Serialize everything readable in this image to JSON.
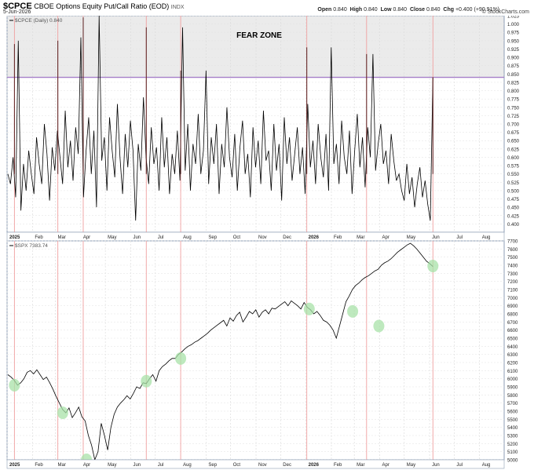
{
  "header": {
    "symbol": "$CPCE",
    "name": "CBOE Options Equity Put/Call Ratio (EOD)",
    "exchange": "INDX",
    "date": "5-Jun-2026",
    "brand": "© StockCharts.com",
    "ohlc": {
      "open_label": "Open",
      "open": "0.840",
      "high_label": "High",
      "high": "0.840",
      "low_label": "Low",
      "low": "0.840",
      "close_label": "Close",
      "close": "0.840",
      "chg_label": "Chg",
      "chg": "+0.400 (+90.91%)"
    }
  },
  "colors": {
    "frame": "#8e9eb4",
    "fear_zone_fill": "#ebebeb",
    "threshold_line": "#a57ec8",
    "event_line": "#f0a0a0",
    "marker_fill": "#a8e2a8",
    "price_line": "#000000"
  },
  "chart_data": [
    {
      "type": "line",
      "legend": "$CPCE (Daily) 0.840",
      "annotation": "FEAR ZONE",
      "ylim": [
        0.375,
        1.025
      ],
      "yticks": [
        0.4,
        0.425,
        0.45,
        0.475,
        0.5,
        0.525,
        0.55,
        0.575,
        0.6,
        0.625,
        0.65,
        0.675,
        0.7,
        0.725,
        0.75,
        0.775,
        0.8,
        0.825,
        0.85,
        0.875,
        0.9,
        0.925,
        0.95,
        0.975,
        1.0,
        1.025
      ],
      "fear_zone": [
        0.84,
        1.025
      ],
      "x_tick_labels": [
        "2025",
        "Feb",
        "Mar",
        "Apr",
        "May",
        "Jun",
        "Jul",
        "Aug",
        "Sep",
        "Oct",
        "Nov",
        "Dec",
        "2026",
        "Feb",
        "Mar",
        "Apr",
        "May",
        "Jun",
        "Jul",
        "Aug"
      ],
      "spikes": [
        {
          "date": "2025-01-10",
          "value": 0.94
        },
        {
          "date": "2025-03-04",
          "value": 0.95
        },
        {
          "date": "2025-04-04",
          "value": 1.02
        },
        {
          "date": "2025-06-20",
          "value": 0.99
        },
        {
          "date": "2025-08-01",
          "value": 0.86
        },
        {
          "date": "2026-01-02",
          "value": 0.93
        },
        {
          "date": "2026-03-16",
          "value": 0.91
        },
        {
          "date": "2026-06-05",
          "value": 0.84
        }
      ],
      "series": [
        {
          "values": [
            0.55,
            0.52,
            0.6,
            0.48,
            0.95,
            0.44,
            0.58,
            0.5,
            0.62,
            0.55,
            0.49,
            0.66,
            0.58,
            0.52,
            0.7,
            0.61,
            0.47,
            0.63,
            0.56,
            0.68,
            0.6,
            0.52,
            0.74,
            0.57,
            0.65,
            0.53,
            0.69,
            0.61,
            0.96,
            0.48,
            0.62,
            0.72,
            0.55,
            0.68,
            0.45,
            1.03,
            0.59,
            0.66,
            0.5,
            0.72,
            0.62,
            0.54,
            0.76,
            0.6,
            0.49,
            0.67,
            0.57,
            0.71,
            0.62,
            0.41,
            0.64,
            0.56,
            0.78,
            0.6,
            0.52,
            0.69,
            0.58,
            0.63,
            0.5,
            0.72,
            0.57,
            0.66,
            0.49,
            0.61,
            0.55,
            0.68,
            0.53,
            0.99,
            0.56,
            0.7,
            0.5,
            0.64,
            0.58,
            0.73,
            0.55,
            0.62,
            0.86,
            0.52,
            0.66,
            0.58,
            0.7,
            0.49,
            0.64,
            0.57,
            0.75,
            0.6,
            0.54,
            0.67,
            0.5,
            0.63,
            0.71,
            0.55,
            0.61,
            0.48,
            0.69,
            0.57,
            0.65,
            0.52,
            0.74,
            0.59,
            0.62,
            0.5,
            0.7,
            0.56,
            0.64,
            0.47,
            0.72,
            0.58,
            0.66,
            0.53,
            0.61,
            0.69,
            0.55,
            0.63,
            0.49,
            0.76,
            0.57,
            0.65,
            0.52,
            0.7,
            0.6,
            0.54,
            0.67,
            0.5,
            0.93,
            0.58,
            0.64,
            0.52,
            0.71,
            0.6,
            0.55,
            0.68,
            0.49,
            0.62,
            0.73,
            0.57,
            0.66,
            0.51,
            0.69,
            0.6,
            0.91,
            0.56,
            0.64,
            0.7,
            0.58,
            0.62,
            0.52,
            0.67,
            0.59,
            0.53,
            0.55,
            0.5,
            0.47,
            0.58,
            0.49,
            0.54,
            0.45,
            0.52,
            0.57,
            0.48,
            0.53,
            0.46,
            0.41,
            0.84
          ]
        }
      ]
    },
    {
      "type": "line",
      "legend": "$SPX 7383.74",
      "ylim": [
        5000,
        7700
      ],
      "yticks": [
        5000,
        5100,
        5200,
        5300,
        5400,
        5500,
        5600,
        5700,
        5800,
        5900,
        6000,
        6100,
        6200,
        6300,
        6400,
        6500,
        6600,
        6700,
        6800,
        6900,
        7000,
        7100,
        7200,
        7300,
        7400,
        7500,
        7600,
        7700
      ],
      "x_tick_labels": [
        "2025",
        "Feb",
        "Mar",
        "Apr",
        "May",
        "Jun",
        "Jul",
        "Aug",
        "Sep",
        "Oct",
        "Nov",
        "Dec",
        "2026",
        "Feb",
        "Mar",
        "Apr",
        "May",
        "Jun",
        "Jul",
        "Aug"
      ],
      "highlights": [
        {
          "date": "2025-01-10",
          "value": 5920
        },
        {
          "date": "2025-03-10",
          "value": 5580
        },
        {
          "date": "2025-04-08",
          "value": 5000
        },
        {
          "date": "2025-06-20",
          "value": 5970
        },
        {
          "date": "2025-08-01",
          "value": 6250
        },
        {
          "date": "2026-01-05",
          "value": 6860
        },
        {
          "date": "2026-02-27",
          "value": 6830
        },
        {
          "date": "2026-03-31",
          "value": 6650
        },
        {
          "date": "2026-06-05",
          "value": 7390
        }
      ],
      "series": [
        {
          "values": [
            6050,
            6020,
            5980,
            5920,
            5950,
            6000,
            6080,
            6100,
            6060,
            6110,
            6050,
            5990,
            6020,
            5950,
            5870,
            5780,
            5700,
            5620,
            5580,
            5640,
            5520,
            5580,
            5650,
            5530,
            5480,
            5300,
            5180,
            5000,
            5100,
            5450,
            5300,
            5120,
            5400,
            5560,
            5650,
            5700,
            5740,
            5790,
            5750,
            5820,
            5900,
            5880,
            5950,
            5940,
            6000,
            6050,
            5970,
            6100,
            6150,
            6180,
            6220,
            6250,
            6250,
            6300,
            6330,
            6370,
            6400,
            6420,
            6450,
            6470,
            6500,
            6530,
            6560,
            6600,
            6630,
            6660,
            6690,
            6720,
            6650,
            6750,
            6710,
            6780,
            6820,
            6700,
            6760,
            6830,
            6800,
            6850,
            6760,
            6820,
            6850,
            6800,
            6870,
            6860,
            6890,
            6920,
            6950,
            6900,
            6960,
            6930,
            6900,
            6860,
            6940,
            6880,
            6850,
            6800,
            6830,
            6780,
            6720,
            6700,
            6660,
            6600,
            6500,
            6650,
            6800,
            6950,
            7020,
            7100,
            7150,
            7180,
            7220,
            7250,
            7270,
            7300,
            7330,
            7350,
            7400,
            7430,
            7450,
            7480,
            7520,
            7560,
            7590,
            7620,
            7650,
            7670,
            7640,
            7600,
            7550,
            7500,
            7450,
            7420,
            7383.74
          ]
        }
      ]
    }
  ]
}
